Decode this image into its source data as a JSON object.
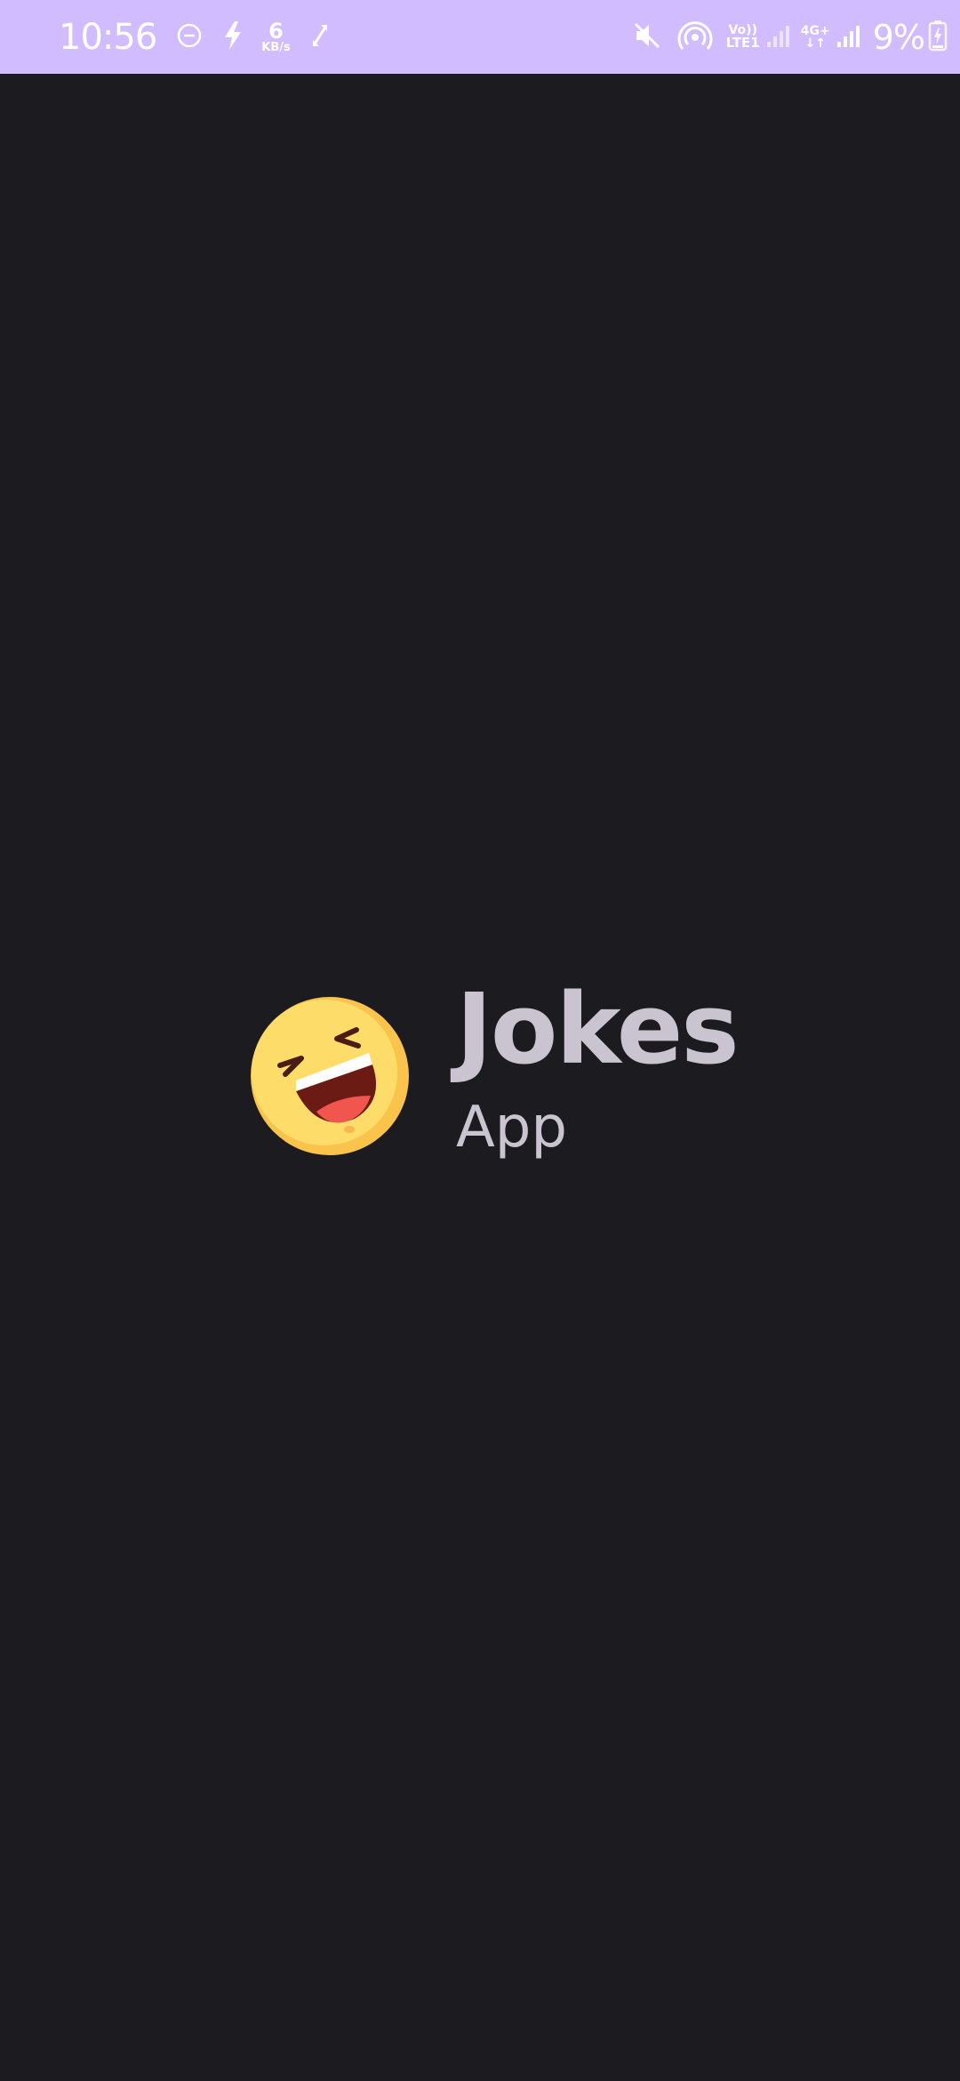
{
  "status_bar": {
    "time": "10:56",
    "net_speed_value": "6",
    "net_speed_unit": "KB/s",
    "volte_top": "Vo))",
    "volte_bottom": "LTE1",
    "net_gen": "4G+",
    "net_arrows": "↓↑",
    "battery": "9%",
    "background": "#d0bcff",
    "icons": [
      "dnd-icon",
      "bolt-icon",
      "sync-icon",
      "mute-icon",
      "hotspot-icon",
      "signal-icon",
      "battery-icon"
    ]
  },
  "splash": {
    "title": "Jokes",
    "subtitle": "App",
    "logo_icon": "laughing-emoji-icon",
    "text_color": "#cac4d0",
    "background": "#1c1b20"
  }
}
